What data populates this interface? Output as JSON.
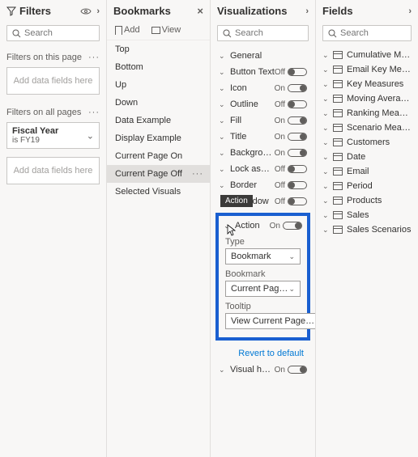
{
  "filters": {
    "title": "Filters",
    "search_placeholder": "Search",
    "this_page_label": "Filters on this page",
    "all_pages_label": "Filters on all pages",
    "add_here": "Add data fields here",
    "slicer_title": "Fiscal Year",
    "slicer_value": "is FY19"
  },
  "bookmarks": {
    "title": "Bookmarks",
    "add": "Add",
    "view": "View",
    "items": [
      "Top",
      "Bottom",
      "Up",
      "Down",
      "Data Example",
      "Display Example",
      "Current Page On",
      "Current Page Off",
      "Selected Visuals"
    ],
    "selected_index": 7
  },
  "viz": {
    "title": "Visualizations",
    "search_placeholder": "Search",
    "rows": [
      {
        "label": "General",
        "toggle": null
      },
      {
        "label": "Button Text",
        "toggle": "off"
      },
      {
        "label": "Icon",
        "toggle": "on"
      },
      {
        "label": "Outline",
        "toggle": "off"
      },
      {
        "label": "Fill",
        "toggle": "on"
      },
      {
        "label": "Title",
        "toggle": "on"
      },
      {
        "label": "Backgrou…",
        "toggle": "on"
      },
      {
        "label": "Lock aspe…",
        "toggle": "off"
      },
      {
        "label": "Border",
        "toggle": "off"
      }
    ],
    "shadow_label": "Shadow",
    "shadow_toggle": "off",
    "tooltip_tag": "Action",
    "action": {
      "label": "Action",
      "toggle": "on",
      "type_label": "Type",
      "type_value": "Bookmark",
      "bookmark_label": "Bookmark",
      "bookmark_value": "Current Page On",
      "tooltip_label": "Tooltip",
      "tooltip_value": "View Current Page…",
      "fx": "fx"
    },
    "revert": "Revert to default",
    "visual_header": {
      "label": "Visual he…",
      "toggle": "on"
    }
  },
  "fields": {
    "title": "Fields",
    "search_placeholder": "Search",
    "tables": [
      "Cumulative Meas…",
      "Email Key Measur…",
      "Key Measures",
      "Moving Averages",
      "Ranking Measures",
      "Scenario Measures",
      "Customers",
      "Date",
      "Email",
      "Period",
      "Products",
      "Sales",
      "Sales Scenarios"
    ]
  }
}
